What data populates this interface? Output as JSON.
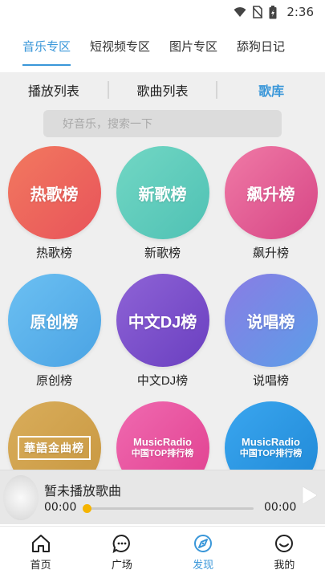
{
  "status": {
    "time": "2:36"
  },
  "top_tabs": [
    {
      "label": "音乐专区",
      "active": true
    },
    {
      "label": "短视频专区",
      "active": false
    },
    {
      "label": "图片专区",
      "active": false
    },
    {
      "label": "舔狗日记",
      "active": false
    }
  ],
  "sub_tabs": [
    {
      "label": "播放列表"
    },
    {
      "label": "歌曲列表"
    },
    {
      "label": "歌库"
    }
  ],
  "search": {
    "placeholder": "好音乐，搜索一下"
  },
  "charts": [
    {
      "circle_text": "热歌榜",
      "label": "热歌榜",
      "color_from": "#f2795f",
      "color_to": "#e8535a"
    },
    {
      "circle_text": "新歌榜",
      "label": "新歌榜",
      "color_from": "#72d7c4",
      "color_to": "#4fc1b4"
    },
    {
      "circle_text": "飙升榜",
      "label": "飙升榜",
      "color_from": "#f07aa6",
      "color_to": "#d64585"
    },
    {
      "circle_text": "原创榜",
      "label": "原创榜",
      "color_from": "#6cc0f2",
      "color_to": "#4aa3e4"
    },
    {
      "circle_text": "中文DJ榜",
      "label": "中文DJ榜",
      "color_from": "#8e63d6",
      "color_to": "#6a3fc0"
    },
    {
      "circle_text": "说唱榜",
      "label": "说唱榜",
      "color_from": "#8a7ce4",
      "color_to": "#5b9ee8"
    },
    {
      "circle_text": "華語金曲榜",
      "label": "",
      "color_from": "#d9ad5b",
      "color_to": "#c89740"
    },
    {
      "circle_text": "中国TOP排行榜",
      "logo_top": "MusicRadio",
      "label": "",
      "color_from": "#f06ab0",
      "color_to": "#e03f8f"
    },
    {
      "circle_text": "中国TOP排行榜",
      "logo_top": "MusicRadio",
      "label": "",
      "color_from": "#3aa6ef",
      "color_to": "#1f88d6"
    }
  ],
  "player": {
    "title": "暂未播放歌曲",
    "current_time": "00:00",
    "total_time": "00:00",
    "progress": 0
  },
  "bottom_nav": [
    {
      "label": "首页",
      "icon": "home-icon",
      "active": false
    },
    {
      "label": "广场",
      "icon": "chat-icon",
      "active": false
    },
    {
      "label": "发现",
      "icon": "discover-icon",
      "active": true
    },
    {
      "label": "我的",
      "icon": "smiley-icon",
      "active": false
    }
  ],
  "colors": {
    "accent": "#3a97d9",
    "progress": "#f5b400"
  }
}
